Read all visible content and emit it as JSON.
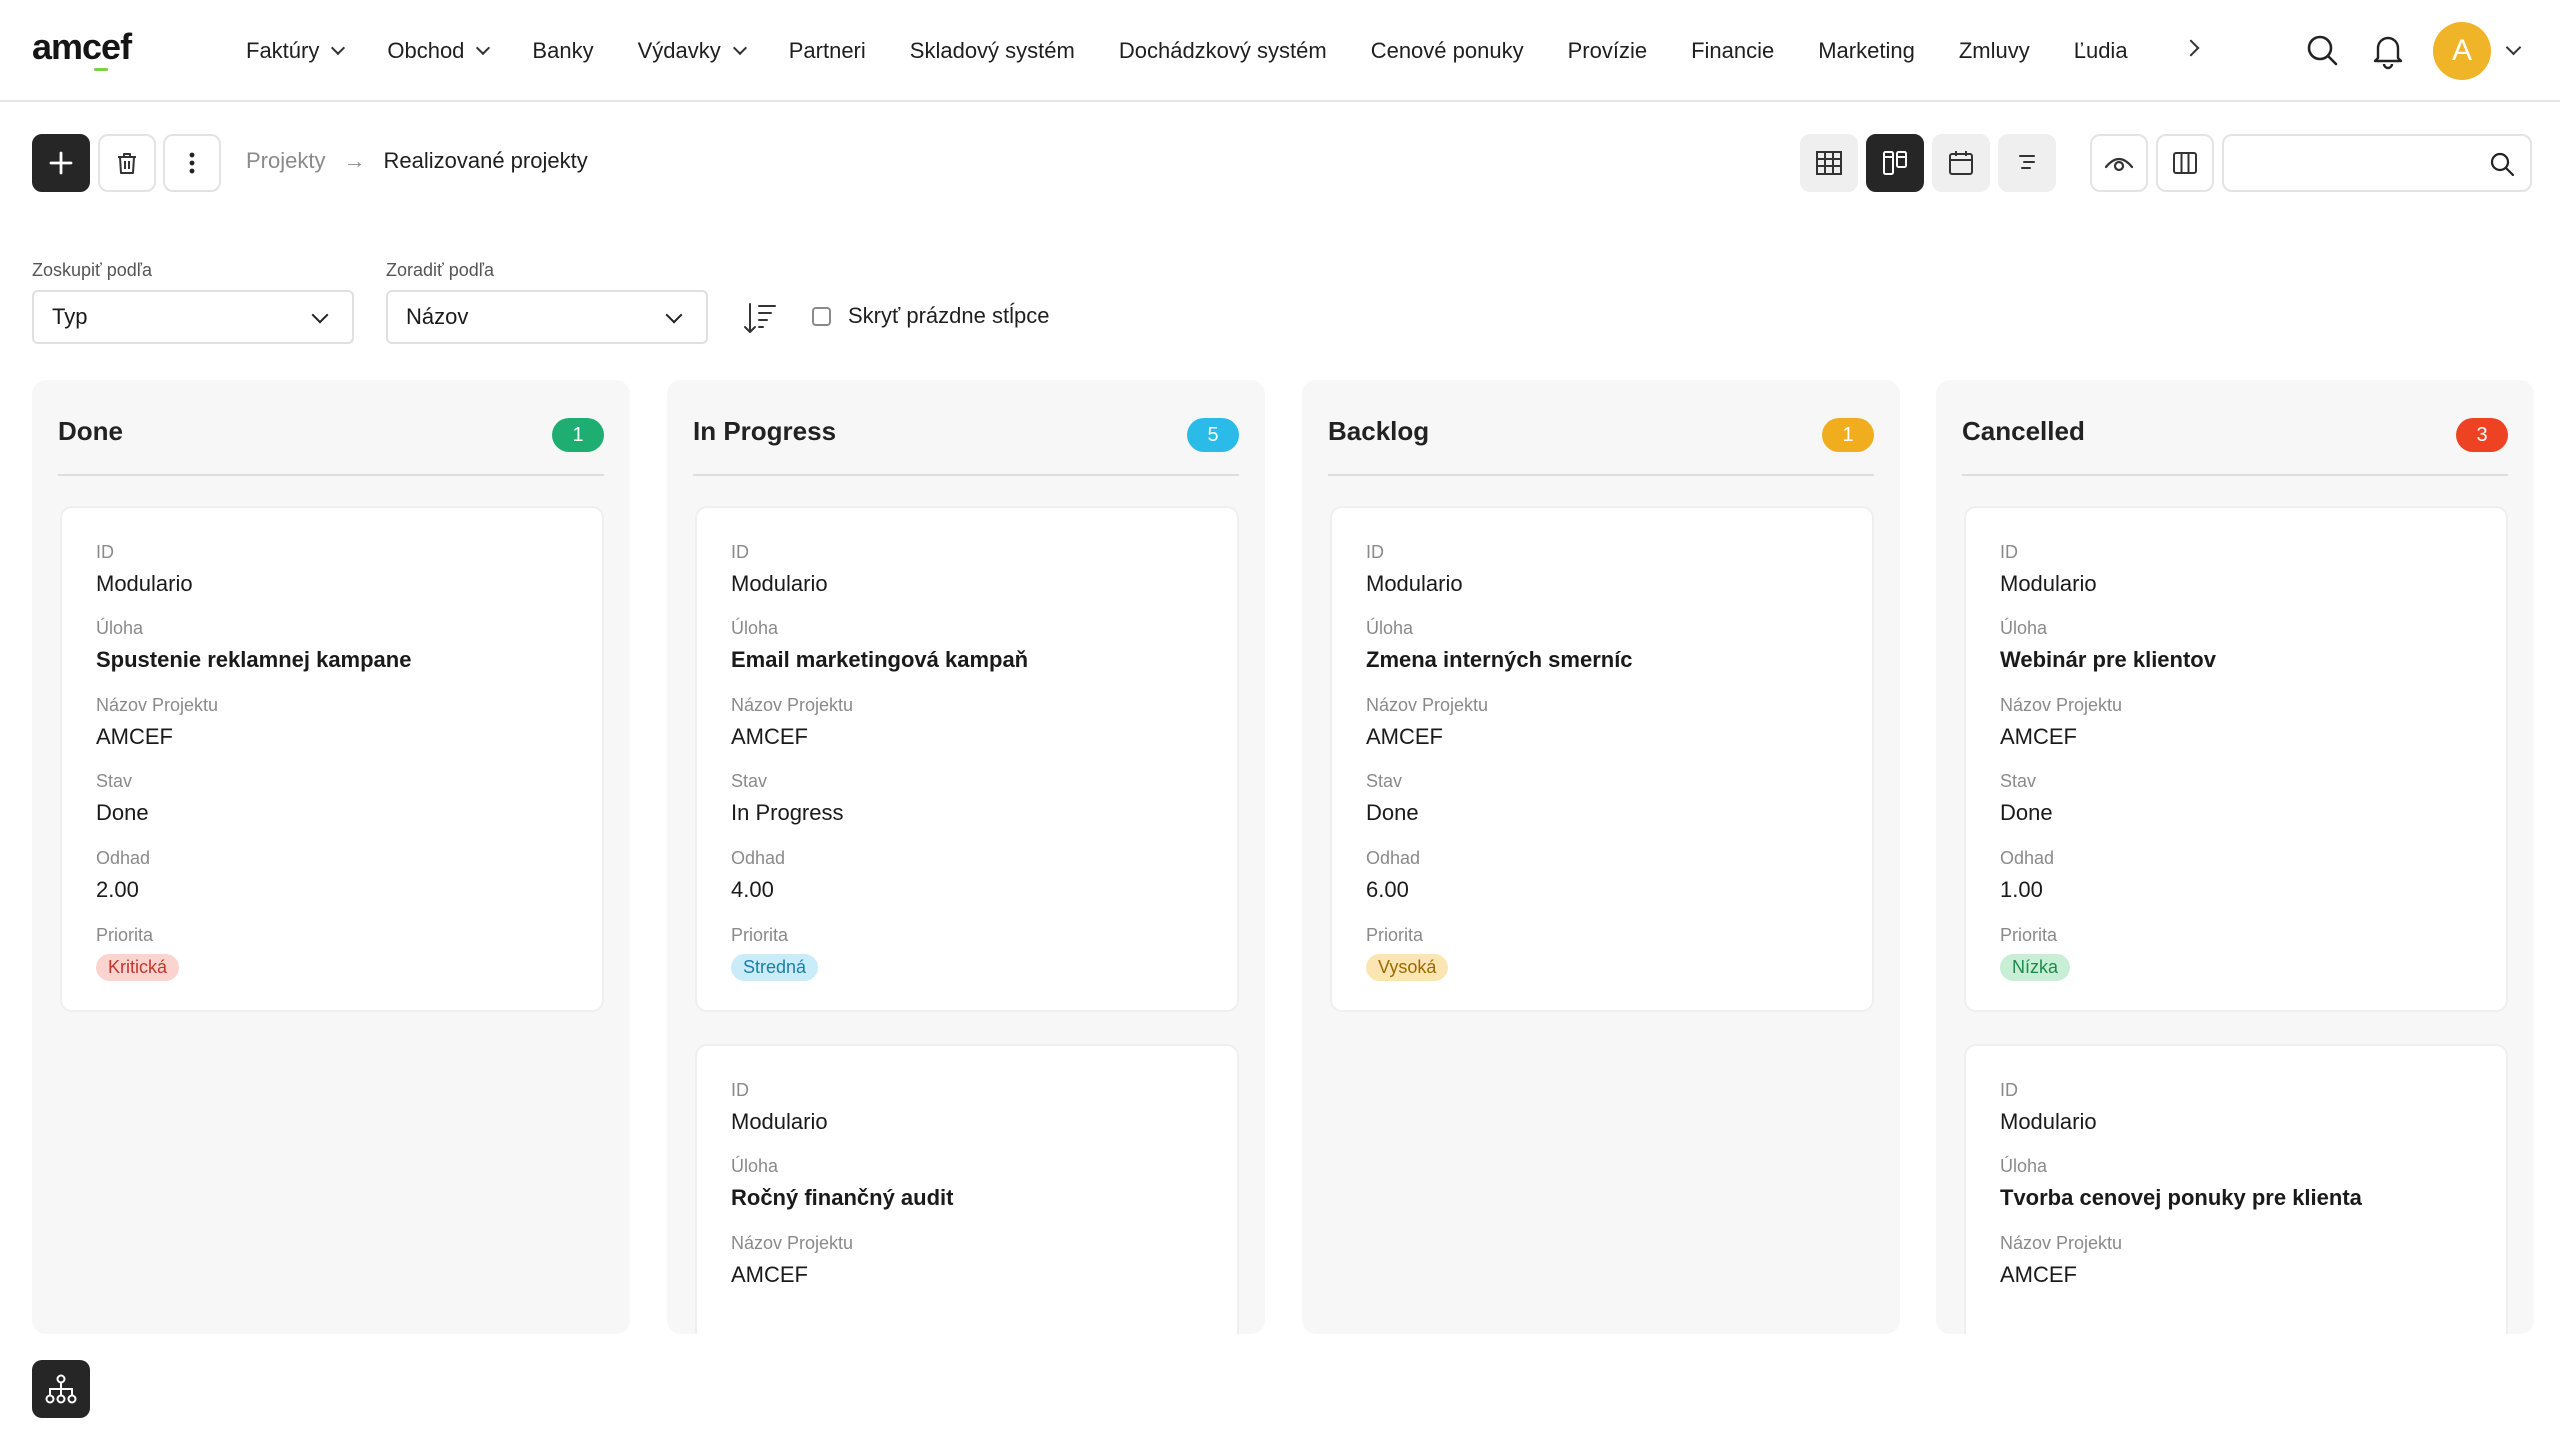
{
  "brand": {
    "logo_text": "amcef"
  },
  "nav": {
    "items": [
      {
        "label": "Faktúry",
        "dropdown": true
      },
      {
        "label": "Obchod",
        "dropdown": true
      },
      {
        "label": "Banky",
        "dropdown": false
      },
      {
        "label": "Výdavky",
        "dropdown": true
      },
      {
        "label": "Partneri",
        "dropdown": false
      },
      {
        "label": "Skladový systém",
        "dropdown": false
      },
      {
        "label": "Dochádzkový systém",
        "dropdown": false
      },
      {
        "label": "Cenové ponuky",
        "dropdown": false
      },
      {
        "label": "Provízie",
        "dropdown": false
      },
      {
        "label": "Financie",
        "dropdown": false
      },
      {
        "label": "Marketing",
        "dropdown": false
      },
      {
        "label": "Zmluvy",
        "dropdown": false
      },
      {
        "label": "Ľudia",
        "dropdown": false
      }
    ],
    "more_icon": "chevron-right-icon",
    "search_icon": "search-icon",
    "notification_icon": "bell-icon",
    "avatar_initial": "A",
    "avatar_color": "#f0b429"
  },
  "toolbar": {
    "add_icon": "plus-icon",
    "delete_icon": "trash-icon",
    "more_icon": "more-vertical-icon",
    "breadcrumb": {
      "parent": "Projekty",
      "separator": "→",
      "current": "Realizované projekty"
    },
    "view_icons": [
      "table-view-icon",
      "kanban-view-icon",
      "calendar-view-icon",
      "list-view-icon"
    ],
    "active_view": "kanban-view-icon",
    "visibility_icon": "eye-icon",
    "columns_icon": "columns-icon",
    "search": {
      "value": "",
      "placeholder": ""
    }
  },
  "filters": {
    "group_label": "Zoskupiť podľa",
    "group_value": "Typ",
    "sort_label": "Zoradiť podľa",
    "sort_value": "Názov",
    "sort_direction_icon": "sort-descending-icon",
    "hide_empty_label": "Skryť prázdne stĺpce",
    "hide_empty_checked": false
  },
  "field_labels": {
    "id": "ID",
    "task": "Úloha",
    "project": "Názov Projektu",
    "status": "Stav",
    "estimate": "Odhad",
    "priority": "Priorita"
  },
  "columns": [
    {
      "title": "Done",
      "count": "1",
      "color": "#1fae72",
      "cards": [
        {
          "id": "Modulario",
          "task": "Spustenie reklamnej kampane",
          "project": "AMCEF",
          "status": "Done",
          "estimate": "2.00",
          "priority": "Kritická",
          "priority_bg": "#fbd3cf",
          "priority_fg": "#c2362b"
        }
      ]
    },
    {
      "title": "In Progress",
      "count": "5",
      "color": "#2bbbe8",
      "cards": [
        {
          "id": "Modulario",
          "task": "Email marketingová kampaň",
          "project": "AMCEF",
          "status": "In Progress",
          "estimate": "4.00",
          "priority": "Stredná",
          "priority_bg": "#c9ecf8",
          "priority_fg": "#1a7fa6"
        },
        {
          "id": "Modulario",
          "task": "Ročný finančný audit",
          "project": "AMCEF"
        }
      ]
    },
    {
      "title": "Backlog",
      "count": "1",
      "color": "#f0ad1e",
      "cards": [
        {
          "id": "Modulario",
          "task": "Zmena interných smerníc",
          "project": "AMCEF",
          "status": "Done",
          "estimate": "6.00",
          "priority": "Vysoká",
          "priority_bg": "#fbe6b3",
          "priority_fg": "#9a6a00"
        }
      ]
    },
    {
      "title": "Cancelled",
      "count": "3",
      "color": "#ee4322",
      "cards": [
        {
          "id": "Modulario",
          "task": "Webinár pre klientov",
          "project": "AMCEF",
          "status": "Done",
          "estimate": "1.00",
          "priority": "Nízka",
          "priority_bg": "#c8efd6",
          "priority_fg": "#1d8a4c"
        },
        {
          "id": "Modulario",
          "task": "Tvorba cenovej ponuky pre klienta",
          "project": "AMCEF"
        }
      ]
    }
  ],
  "floating": {
    "icon": "hierarchy-icon"
  }
}
